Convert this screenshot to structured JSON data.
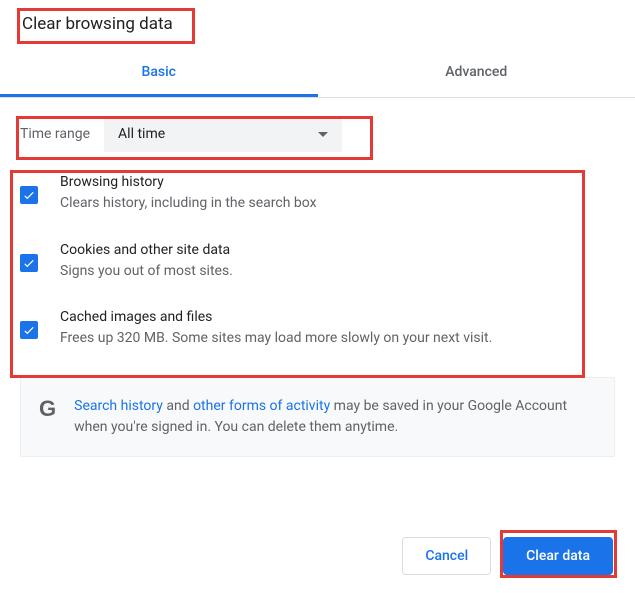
{
  "title": "Clear browsing data",
  "tabs": {
    "basic": "Basic",
    "advanced": "Advanced"
  },
  "timerange": {
    "label": "Time range",
    "value": "All time"
  },
  "options": [
    {
      "title": "Browsing history",
      "desc": "Clears history, including in the search box"
    },
    {
      "title": "Cookies and other site data",
      "desc": "Signs you out of most sites."
    },
    {
      "title": "Cached images and files",
      "desc": "Frees up 320 MB. Some sites may load more slowly on your next visit."
    }
  ],
  "info": {
    "link1": "Search history",
    "mid1": " and ",
    "link2": "other forms of activity",
    "rest": " may be saved in your Google Account when you're signed in. You can delete them anytime."
  },
  "buttons": {
    "cancel": "Cancel",
    "clear": "Clear data"
  }
}
